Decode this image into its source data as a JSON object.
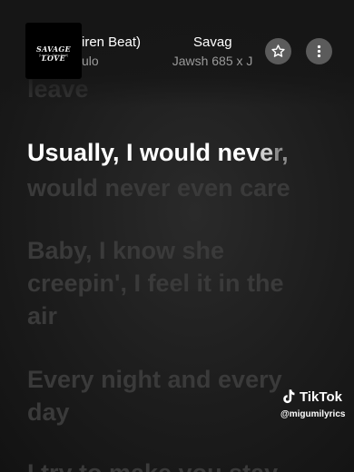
{
  "now_playing": {
    "album_art_title": "SAVAGE LOVE",
    "album_art_subtitle": "(Laxed – Siren Beat)",
    "title_left": "iren Beat)",
    "title_right": "Savag",
    "artist_left": "ulo",
    "artist_right": "Jawsh 685 x J"
  },
  "lyrics": {
    "prev_line": "leave",
    "active_line_main": "Usually, I would nev",
    "active_line_fade1": "e",
    "active_line_fade2": "r,",
    "line2": "would never even care",
    "line3": "Baby, I know she",
    "line4": "creepin', I feel it in the",
    "line5": "air",
    "line6": "Every night and every",
    "line7": "day",
    "line8": "I try to make you stay"
  },
  "watermark": {
    "brand": "TikTok",
    "handle": "@migumilyrics"
  },
  "colors": {
    "active_lyric": "#ffffff",
    "inactive_lyric": "#3a3a3a",
    "button_bg": "#5b5b5b"
  }
}
